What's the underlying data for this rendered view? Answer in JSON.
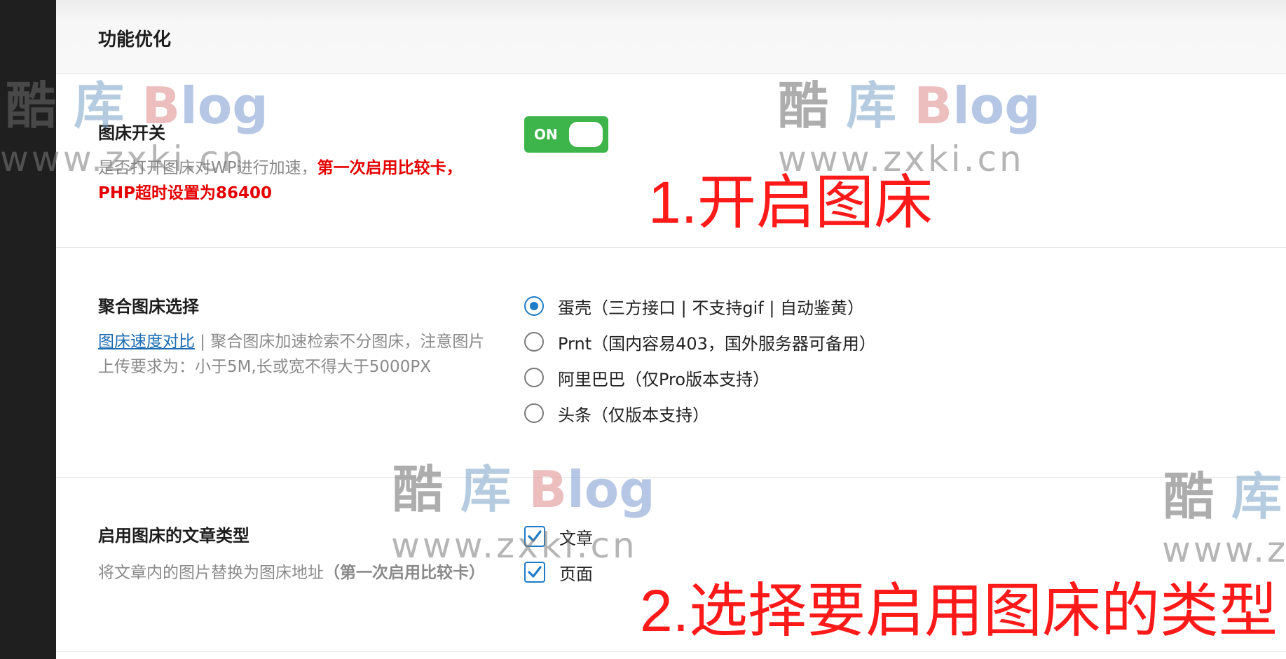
{
  "header": {
    "title": "功能优化"
  },
  "image_host_switch": {
    "title": "图床开关",
    "desc_plain": "是否打开图床对WP进行加速，",
    "desc_red": "第一次启用比较卡，PHP超时设置为86400",
    "toggle_label": "ON",
    "toggle_state": true
  },
  "aggregate_select": {
    "title": "聚合图床选择",
    "link_text": "图床速度对比",
    "desc_rest": " | 聚合图床加速检索不分图床，注意图片上传要求为：小于5M,长或宽不得大于5000PX",
    "options": [
      {
        "label": "蛋壳（三方接口 | 不支持gif | 自动鉴黄）",
        "checked": true
      },
      {
        "label": "Prnt（国内容易403，国外服务器可备用）",
        "checked": false
      },
      {
        "label": "阿里巴巴（仅Pro版本支持）",
        "checked": false
      },
      {
        "label": "头条（仅版本支持）",
        "checked": false
      }
    ]
  },
  "post_types": {
    "title": "启用图床的文章类型",
    "desc_plain": "将文章内的图片替换为图床地址",
    "desc_bold": "（第一次启用比较卡）",
    "options": [
      {
        "label": "文章",
        "checked": true
      },
      {
        "label": "页面",
        "checked": true
      }
    ]
  },
  "annotations": {
    "step1": "1.开启图床",
    "step2": "2.选择要启用图床的类型"
  },
  "watermark": {
    "cn": [
      "酷",
      "库",
      "B",
      "log"
    ],
    "cn_partial": [
      "酷",
      "库"
    ],
    "url": "www.zxki.cn",
    "url_partial": "www.z"
  },
  "colors": {
    "toggle_on": "#3db54a",
    "accent_blue": "#1e7cc6",
    "annotation_red": "#ff1a1a",
    "sidebar": "#1f1f1f"
  }
}
